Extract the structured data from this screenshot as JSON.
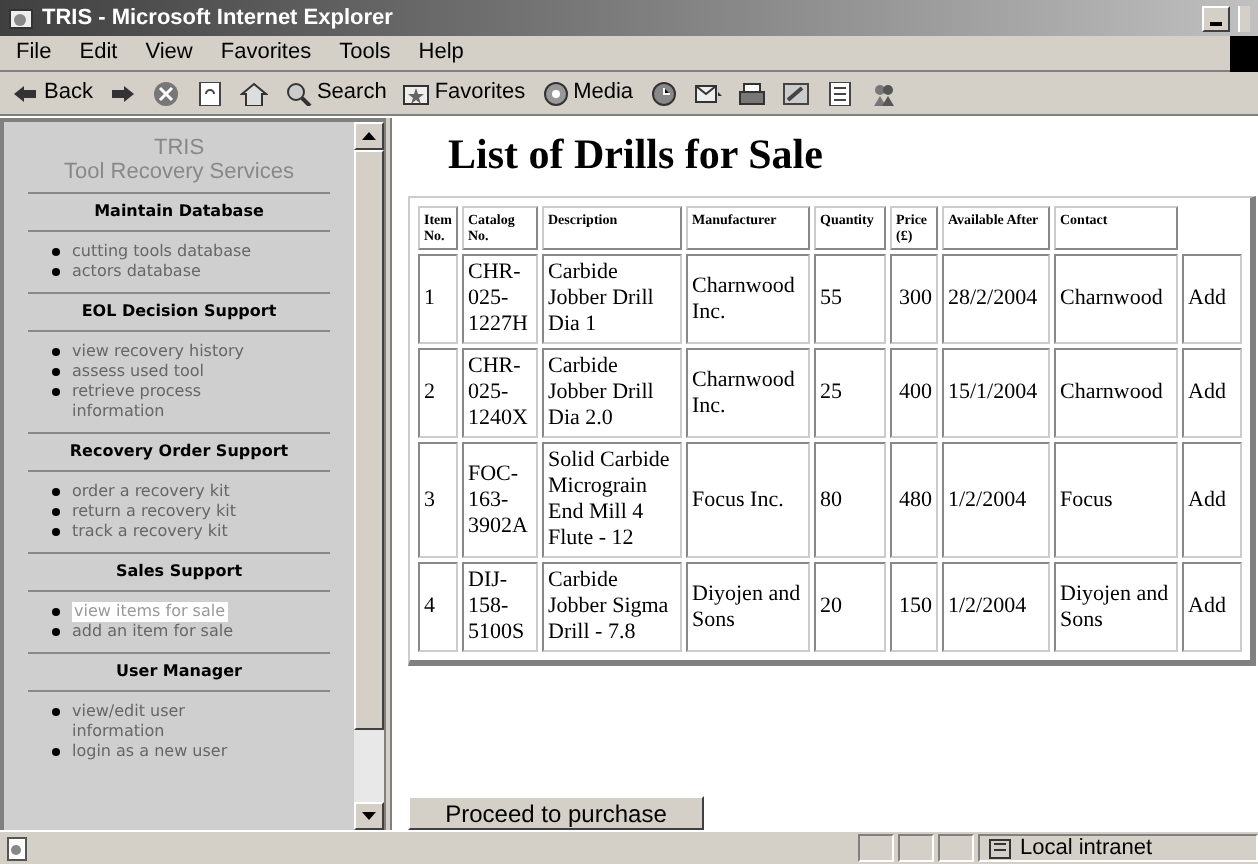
{
  "window": {
    "title": "TRIS - Microsoft Internet Explorer"
  },
  "menu": [
    "File",
    "Edit",
    "View",
    "Favorites",
    "Tools",
    "Help"
  ],
  "toolbar": [
    {
      "kind": "back",
      "label": "Back"
    },
    {
      "kind": "forward"
    },
    {
      "kind": "stop"
    },
    {
      "kind": "refresh"
    },
    {
      "kind": "home"
    },
    {
      "kind": "search",
      "label": "Search"
    },
    {
      "kind": "favorites",
      "label": "Favorites"
    },
    {
      "kind": "media",
      "label": "Media"
    },
    {
      "kind": "history"
    },
    {
      "kind": "mail"
    },
    {
      "kind": "print"
    },
    {
      "kind": "edit"
    },
    {
      "kind": "discuss"
    },
    {
      "kind": "messenger"
    }
  ],
  "sidebar": {
    "title": "TRIS",
    "subtitle": "Tool Recovery Services",
    "sections": [
      {
        "heading": "Maintain Database",
        "items": [
          {
            "label": "cutting tools database",
            "selected": false
          },
          {
            "label": "actors database",
            "selected": false
          }
        ]
      },
      {
        "heading": "EOL Decision Support",
        "items": [
          {
            "label": "view recovery history",
            "selected": false
          },
          {
            "label": "assess used tool",
            "selected": false
          },
          {
            "label": "retrieve process information",
            "selected": false
          }
        ]
      },
      {
        "heading": "Recovery Order Support",
        "items": [
          {
            "label": "order a recovery kit",
            "selected": false
          },
          {
            "label": "return a recovery kit",
            "selected": false
          },
          {
            "label": "track a recovery kit",
            "selected": false
          }
        ]
      },
      {
        "heading": "Sales Support",
        "items": [
          {
            "label": "view items for sale",
            "selected": true
          },
          {
            "label": "add an item for sale",
            "selected": false
          }
        ]
      },
      {
        "heading": "User Manager",
        "items": [
          {
            "label": "view/edit user information",
            "selected": false
          },
          {
            "label": "login as a new user",
            "selected": false
          }
        ]
      }
    ]
  },
  "page": {
    "heading": "List of Drills for Sale"
  },
  "table": {
    "columns": [
      "Item No.",
      "Catalog No.",
      "Description",
      "Manufacturer",
      "Quantity",
      "Price (£)",
      "Available After",
      "Contact"
    ],
    "rows": [
      {
        "cells": [
          "1",
          "CHR-025-1227H",
          "Carbide Jobber Drill Dia 1",
          "Charnwood Inc.",
          "55",
          "300",
          "28/2/2004",
          "Charnwood"
        ],
        "action": "Add"
      },
      {
        "cells": [
          "2",
          "CHR-025-1240X",
          "Carbide Jobber Drill Dia 2.0",
          "Charnwood Inc.",
          "25",
          "400",
          "15/1/2004",
          "Charnwood"
        ],
        "action": "Add"
      },
      {
        "cells": [
          "3",
          "FOC-163-3902A",
          "Solid Carbide Micrograin End Mill 4 Flute - 12",
          "Focus Inc.",
          "80",
          "480",
          "1/2/2004",
          "Focus"
        ],
        "action": "Add"
      },
      {
        "cells": [
          "4",
          "DIJ-158-5100S",
          "Carbide Jobber Sigma Drill - 7.8",
          "Diyojen and Sons",
          "20",
          "150",
          "1/2/2004",
          "Diyojen and Sons"
        ],
        "action": "Add"
      }
    ]
  },
  "button": "Proceed to purchase",
  "status_bar": {
    "zone": "Local intranet"
  }
}
